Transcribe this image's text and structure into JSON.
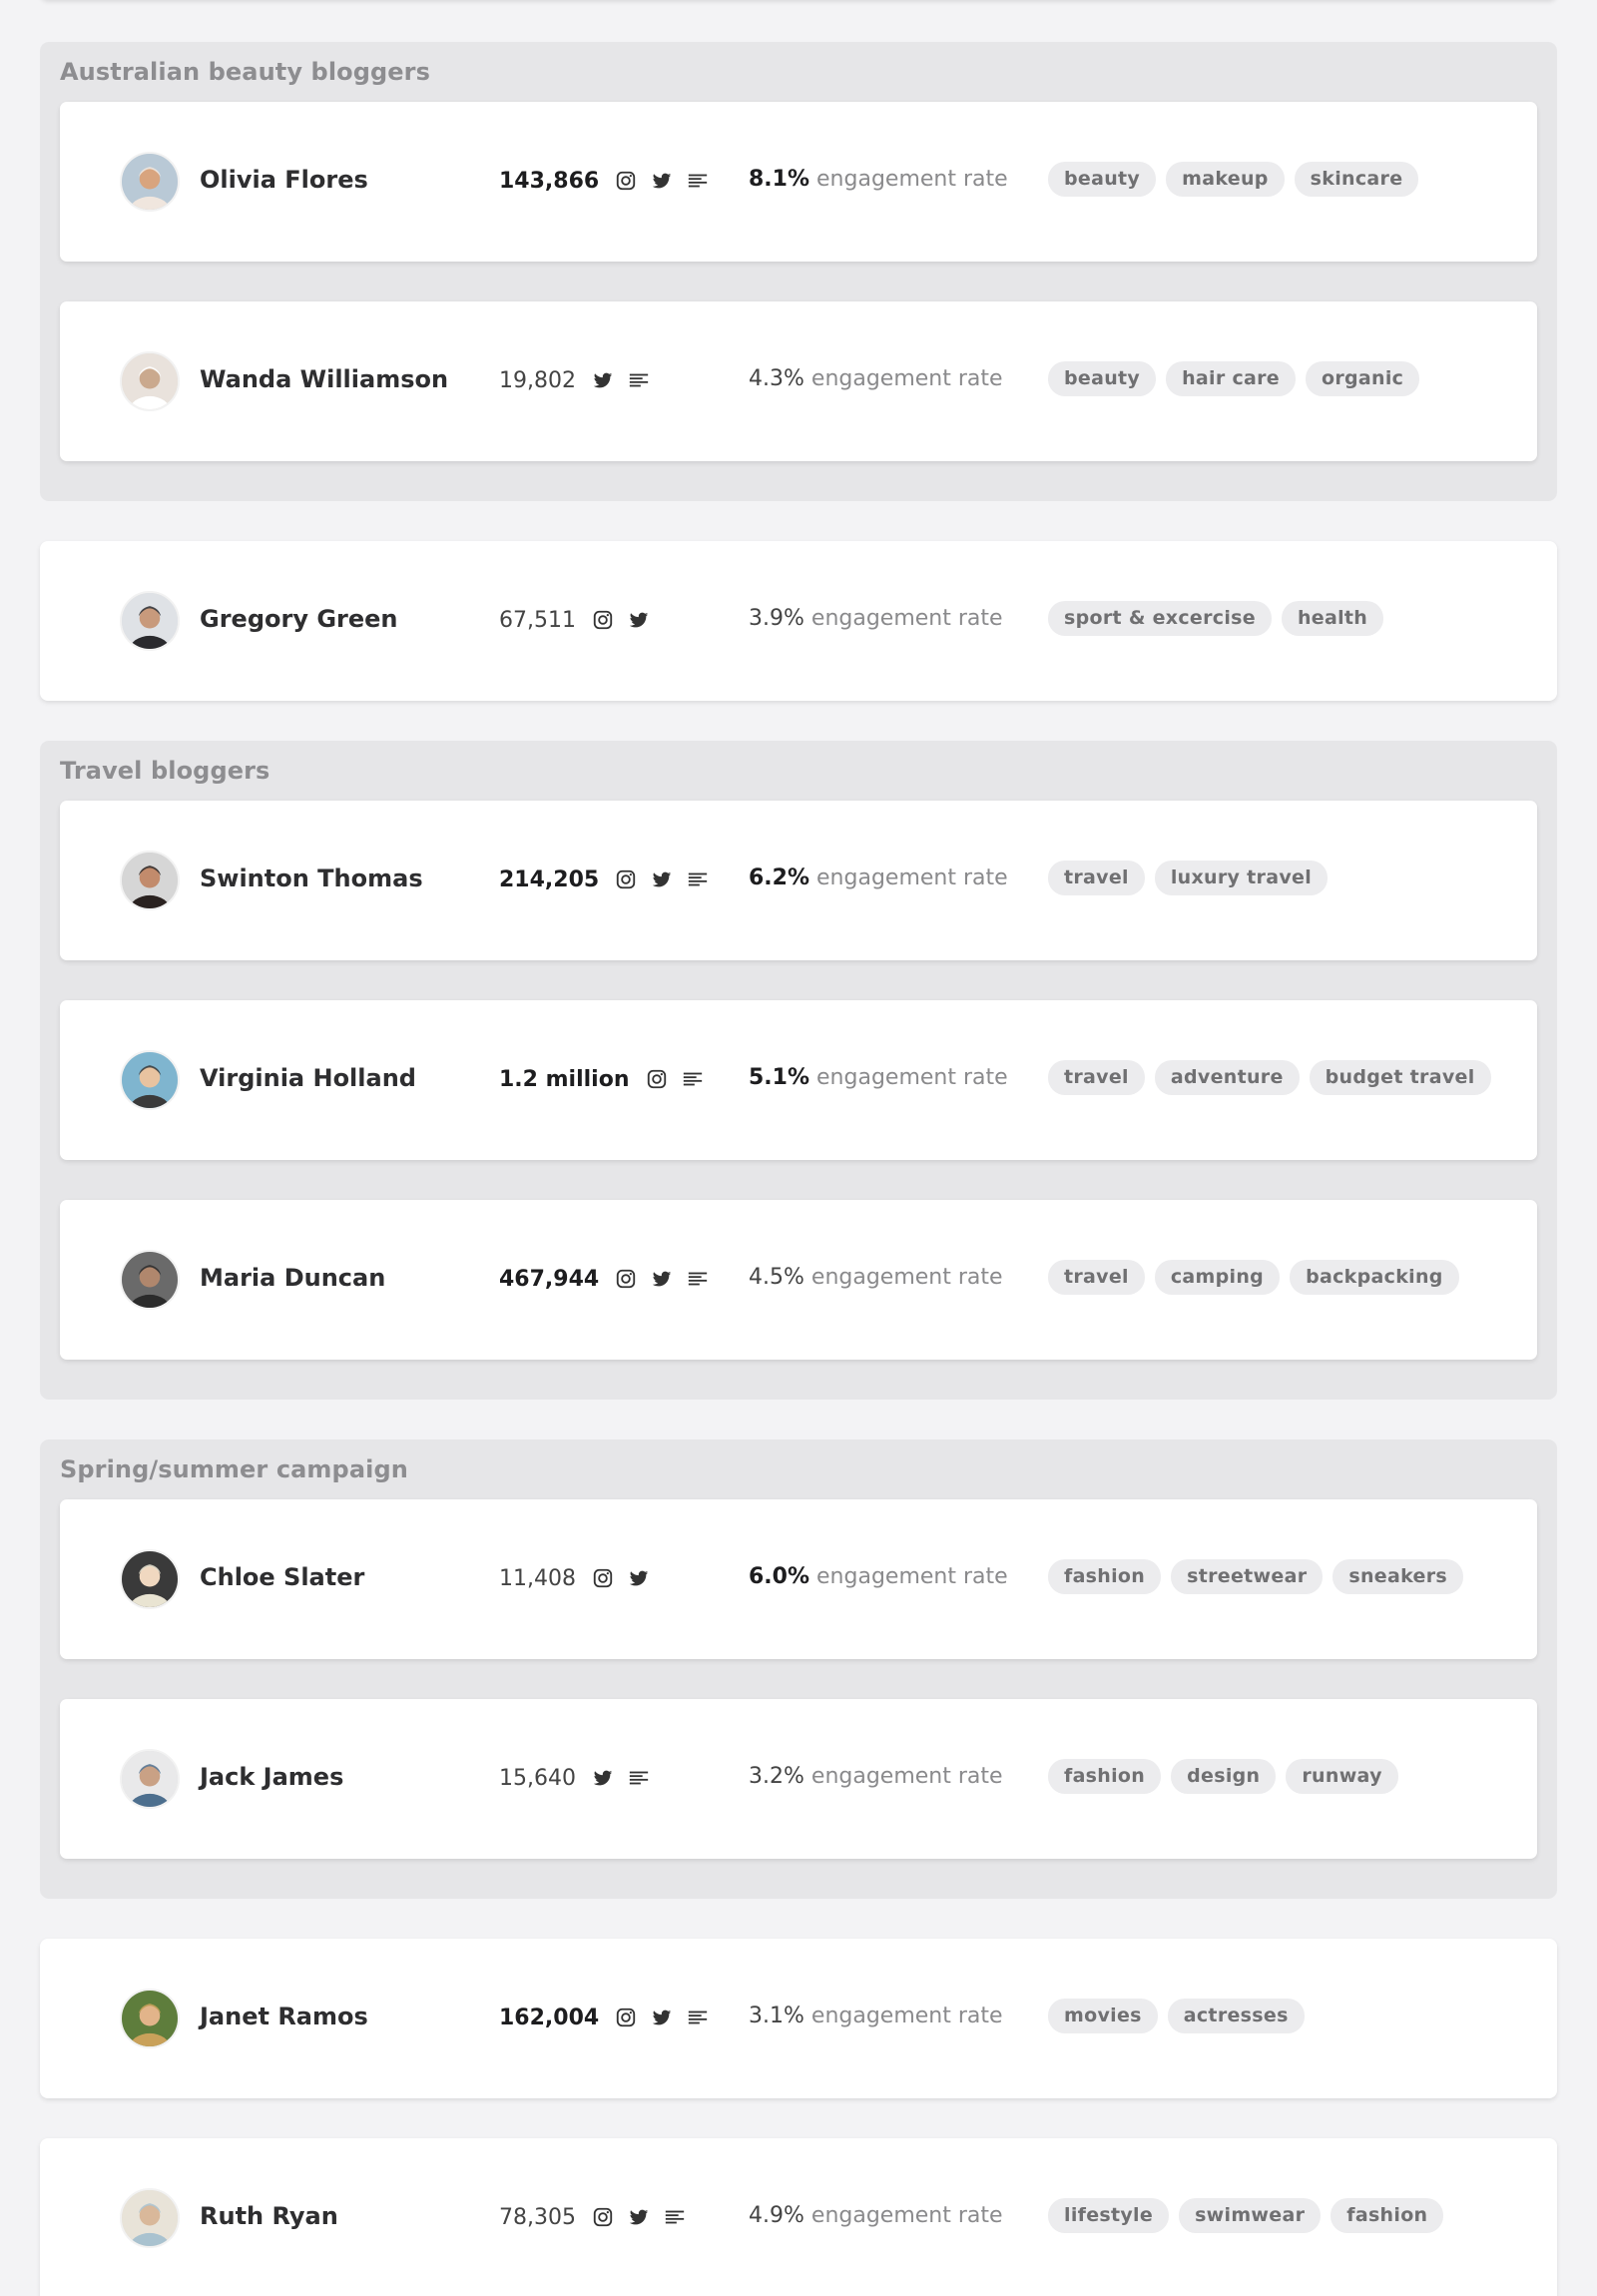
{
  "engagement_label": "engagement rate",
  "groups": [
    {
      "title": "Australian beauty bloggers"
    },
    {
      "title": "Travel bloggers"
    },
    {
      "title": "Spring/summer campaign"
    }
  ],
  "influencers": [
    {
      "name": "Olivia Flores",
      "reach": "143,866",
      "reach_bold": true,
      "platforms": [
        "instagram-icon",
        "twitter-icon",
        "blog-icon"
      ],
      "engagement": "8.1%",
      "engagement_bold": true,
      "tags": [
        "beauty",
        "makeup",
        "skincare"
      ],
      "avatar_colors": [
        "#b9c9d6",
        "#d8a47e",
        "#f0e6de"
      ]
    },
    {
      "name": "Wanda Williamson",
      "reach": "19,802",
      "reach_bold": false,
      "platforms": [
        "twitter-icon",
        "blog-icon"
      ],
      "engagement": "4.3%",
      "engagement_bold": false,
      "tags": [
        "beauty",
        "hair care",
        "organic"
      ],
      "avatar_colors": [
        "#e9e2dc",
        "#caa98e",
        "#ffffff"
      ]
    },
    {
      "name": "Gregory Green",
      "reach": "67,511",
      "reach_bold": false,
      "platforms": [
        "instagram-icon",
        "twitter-icon"
      ],
      "engagement": "3.9%",
      "engagement_bold": false,
      "tags": [
        "sport & excercise",
        "health"
      ],
      "avatar_colors": [
        "#dfe2e6",
        "#c89a7c",
        "#2a2a2e"
      ]
    },
    {
      "name": "Swinton Thomas",
      "reach": "214,205",
      "reach_bold": true,
      "platforms": [
        "instagram-icon",
        "twitter-icon",
        "blog-icon"
      ],
      "engagement": "6.2%",
      "engagement_bold": true,
      "tags": [
        "travel",
        "luxury travel"
      ],
      "avatar_colors": [
        "#d6d6d6",
        "#c28b6c",
        "#2a2220"
      ]
    },
    {
      "name": "Virginia Holland",
      "reach": "1.2 million",
      "reach_bold": true,
      "platforms": [
        "instagram-icon",
        "blog-icon"
      ],
      "engagement": "5.1%",
      "engagement_bold": true,
      "tags": [
        "travel",
        "adventure",
        "budget travel"
      ],
      "avatar_colors": [
        "#7fb5cf",
        "#e8c3a0",
        "#3a3a3a"
      ]
    },
    {
      "name": "Maria Duncan",
      "reach": "467,944",
      "reach_bold": true,
      "platforms": [
        "instagram-icon",
        "twitter-icon",
        "blog-icon"
      ],
      "engagement": "4.5%",
      "engagement_bold": false,
      "tags": [
        "travel",
        "camping",
        "backpacking"
      ],
      "avatar_colors": [
        "#6a6a6a",
        "#b0876d",
        "#2b2b2b"
      ]
    },
    {
      "name": "Chloe Slater",
      "reach": "11,408",
      "reach_bold": false,
      "platforms": [
        "instagram-icon",
        "twitter-icon"
      ],
      "engagement": "6.0%",
      "engagement_bold": true,
      "tags": [
        "fashion",
        "streetwear",
        "sneakers"
      ],
      "avatar_colors": [
        "#3a3a3a",
        "#f0d8c0",
        "#e9e4d2"
      ]
    },
    {
      "name": "Jack James",
      "reach": "15,640",
      "reach_bold": false,
      "platforms": [
        "twitter-icon",
        "blog-icon"
      ],
      "engagement": "3.2%",
      "engagement_bold": false,
      "tags": [
        "fashion",
        "design",
        "runway"
      ],
      "avatar_colors": [
        "#e9e9ea",
        "#c9a185",
        "#4d6f8e"
      ]
    },
    {
      "name": "Janet Ramos",
      "reach": "162,004",
      "reach_bold": true,
      "platforms": [
        "instagram-icon",
        "twitter-icon",
        "blog-icon"
      ],
      "engagement": "3.1%",
      "engagement_bold": false,
      "tags": [
        "movies",
        "actresses"
      ],
      "avatar_colors": [
        "#5e7d3c",
        "#e2b48a",
        "#c9a15a"
      ]
    },
    {
      "name": "Ruth Ryan",
      "reach": "78,305",
      "reach_bold": false,
      "platforms": [
        "instagram-icon",
        "twitter-icon",
        "blog-icon"
      ],
      "engagement": "4.9%",
      "engagement_bold": false,
      "tags": [
        "lifestyle",
        "swimwear",
        "fashion"
      ],
      "avatar_colors": [
        "#e8e3d8",
        "#d9b89a",
        "#a9c2cf"
      ]
    }
  ]
}
